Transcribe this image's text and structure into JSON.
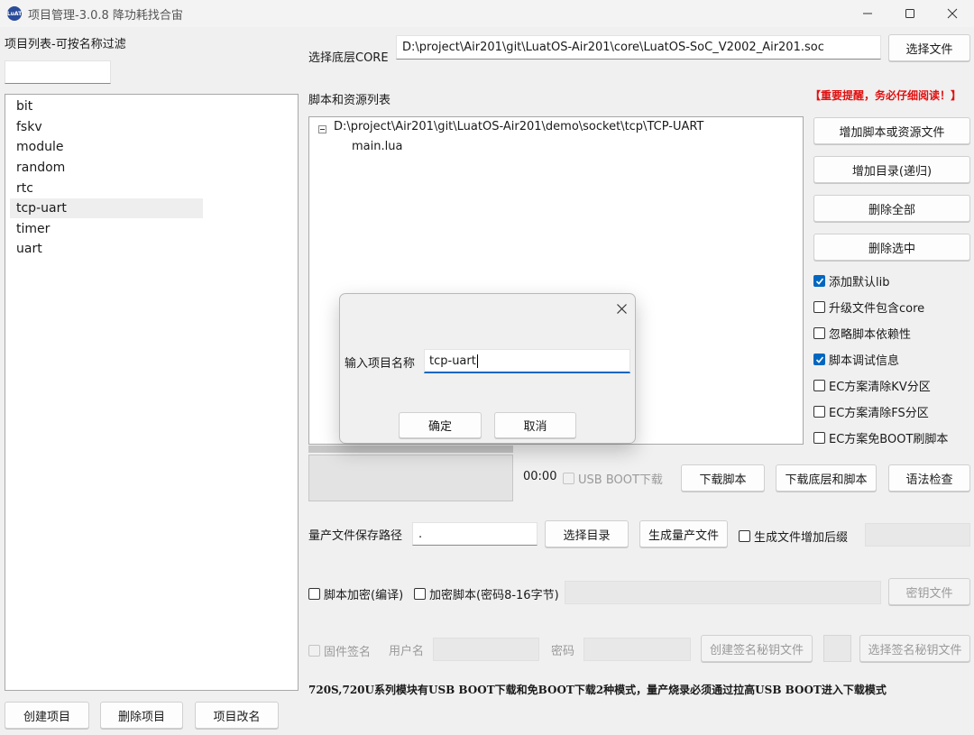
{
  "window": {
    "title": "项目管理-3.0.8 降功耗找合宙",
    "icon": "luat-app-icon",
    "controls": [
      "minimize-icon",
      "maximize-icon",
      "close-icon"
    ]
  },
  "left": {
    "filter_label": "项目列表-可按名称过滤",
    "filter_value": "",
    "projects": [
      "bit",
      "fskv",
      "module",
      "random",
      "rtc",
      "tcp-uart",
      "timer",
      "uart"
    ],
    "selected_index": 5,
    "buttons": {
      "create": "创建项目",
      "delete": "删除项目",
      "rename": "项目改名"
    }
  },
  "core": {
    "label": "选择底层CORE",
    "path": "D:\\project\\Air201\\git\\LuatOS-Air201\\core\\LuatOS-SoC_V2002_Air201.soc",
    "select_button": "选择文件"
  },
  "scripts": {
    "label": "脚本和资源列表",
    "warning": "【重要提醒，务必仔细阅读！】",
    "warning_color": "#e01010",
    "tree": {
      "root": "D:\\project\\Air201\\git\\LuatOS-Air201\\demo\\socket\\tcp\\TCP-UART",
      "children": [
        "main.lua"
      ]
    },
    "buttons": {
      "add_file": "增加脚本或资源文件",
      "add_dir": "增加目录(递归)",
      "delete_all": "删除全部",
      "delete_selected": "删除选中"
    },
    "options": [
      {
        "label": "添加默认lib",
        "checked": true
      },
      {
        "label": "升级文件包含core",
        "checked": false
      },
      {
        "label": "忽略脚本依赖性",
        "checked": false
      },
      {
        "label": "脚本调试信息",
        "checked": true
      },
      {
        "label": "EC方案清除KV分区",
        "checked": false
      },
      {
        "label": "EC方案清除FS分区",
        "checked": false
      },
      {
        "label": "EC方案免BOOT刷脚本",
        "checked": false
      }
    ]
  },
  "download": {
    "time": "00:00",
    "usb_boot_label": "USB BOOT下载",
    "usb_boot_checked": false,
    "download_script": "下载脚本",
    "download_core_script": "下载底层和脚本",
    "syntax_check": "语法检查"
  },
  "mass": {
    "label": "量产文件保存路径",
    "path": ".",
    "select_dir": "选择目录",
    "generate": "生成量产文件",
    "suffix_label": "生成文件增加后缀",
    "suffix_checked": false,
    "suffix_value": ""
  },
  "encrypt": {
    "compile_label": "脚本加密(编译)",
    "compile_checked": false,
    "encrypt_label": "加密脚本(密码8-16字节)",
    "encrypt_checked": false,
    "key_value": "",
    "key_file": "密钥文件"
  },
  "sign": {
    "firmware_sign_label": "固件签名",
    "firmware_sign_checked": false,
    "username_label": "用户名",
    "username_value": "",
    "password_label": "密码",
    "password_value": "",
    "create_key": "创建签名秘钥文件",
    "select_key": "选择签名秘钥文件"
  },
  "notice": "720S,720U系列模块有USB BOOT下载和免BOOT下载2种模式，量产烧录必须通过拉高USB BOOT进入下载模式",
  "dialog": {
    "label": "输入项目名称",
    "value": "tcp-uart",
    "ok": "确定",
    "cancel": "取消"
  }
}
